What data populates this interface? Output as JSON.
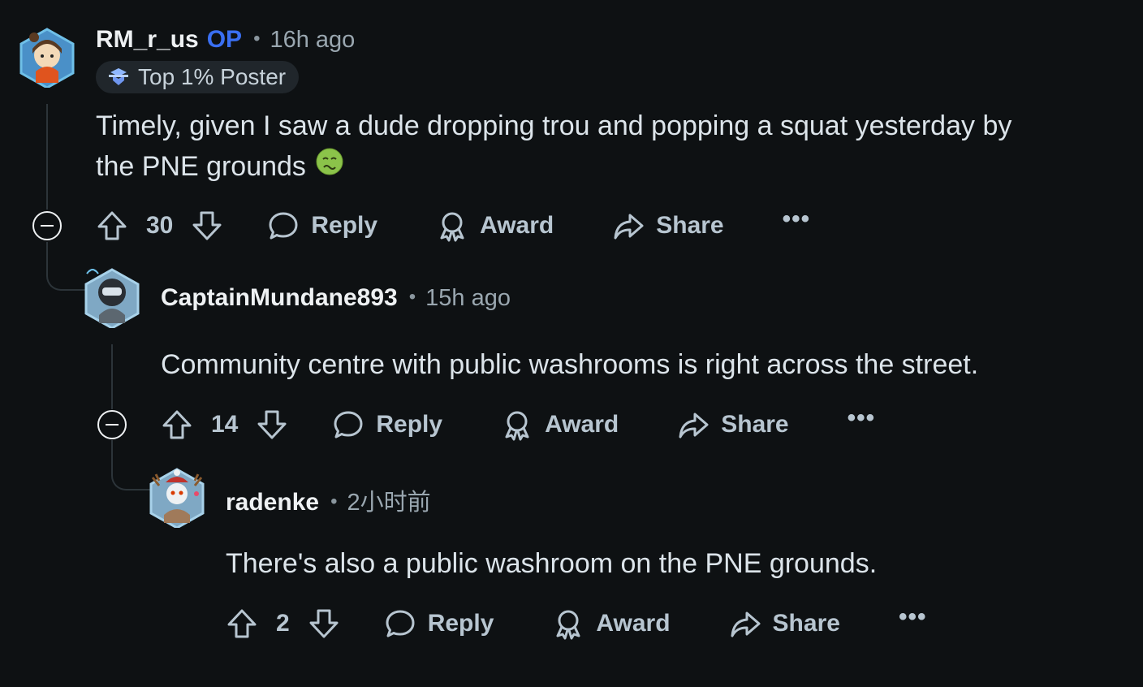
{
  "comments": [
    {
      "username": "RM_r_us",
      "op_badge": "OP",
      "time": "16h ago",
      "flair": "Top 1% Poster",
      "body_line1": "Timely, given I saw a dude dropping trou and popping a squat yesterday by",
      "body_line2": "the PNE grounds",
      "body_emoji": "nauseated-face-emoji",
      "score": "30",
      "reply_label": "Reply",
      "award_label": "Award",
      "share_label": "Share",
      "more_label": "•••"
    },
    {
      "username": "CaptainMundane893",
      "time": "15h ago",
      "body": "Community centre with public washrooms is right across the street.",
      "score": "14",
      "reply_label": "Reply",
      "award_label": "Award",
      "share_label": "Share",
      "more_label": "•••"
    },
    {
      "username": "radenke",
      "time": "2小时前",
      "body": "There's also a public washroom on the PNE grounds.",
      "score": "2",
      "reply_label": "Reply",
      "award_label": "Award",
      "share_label": "Share",
      "more_label": "•••"
    }
  ],
  "separator": "•",
  "colors": {
    "background": "#0e1113",
    "op_badge": "#3a6ff2",
    "text": "#dce4ea",
    "muted": "#9aa7b0",
    "thread_line": "#2c3439"
  },
  "icons": [
    "upvote-icon",
    "downvote-icon",
    "comment-icon",
    "award-icon",
    "share-icon",
    "collapse-icon",
    "more-icon"
  ]
}
